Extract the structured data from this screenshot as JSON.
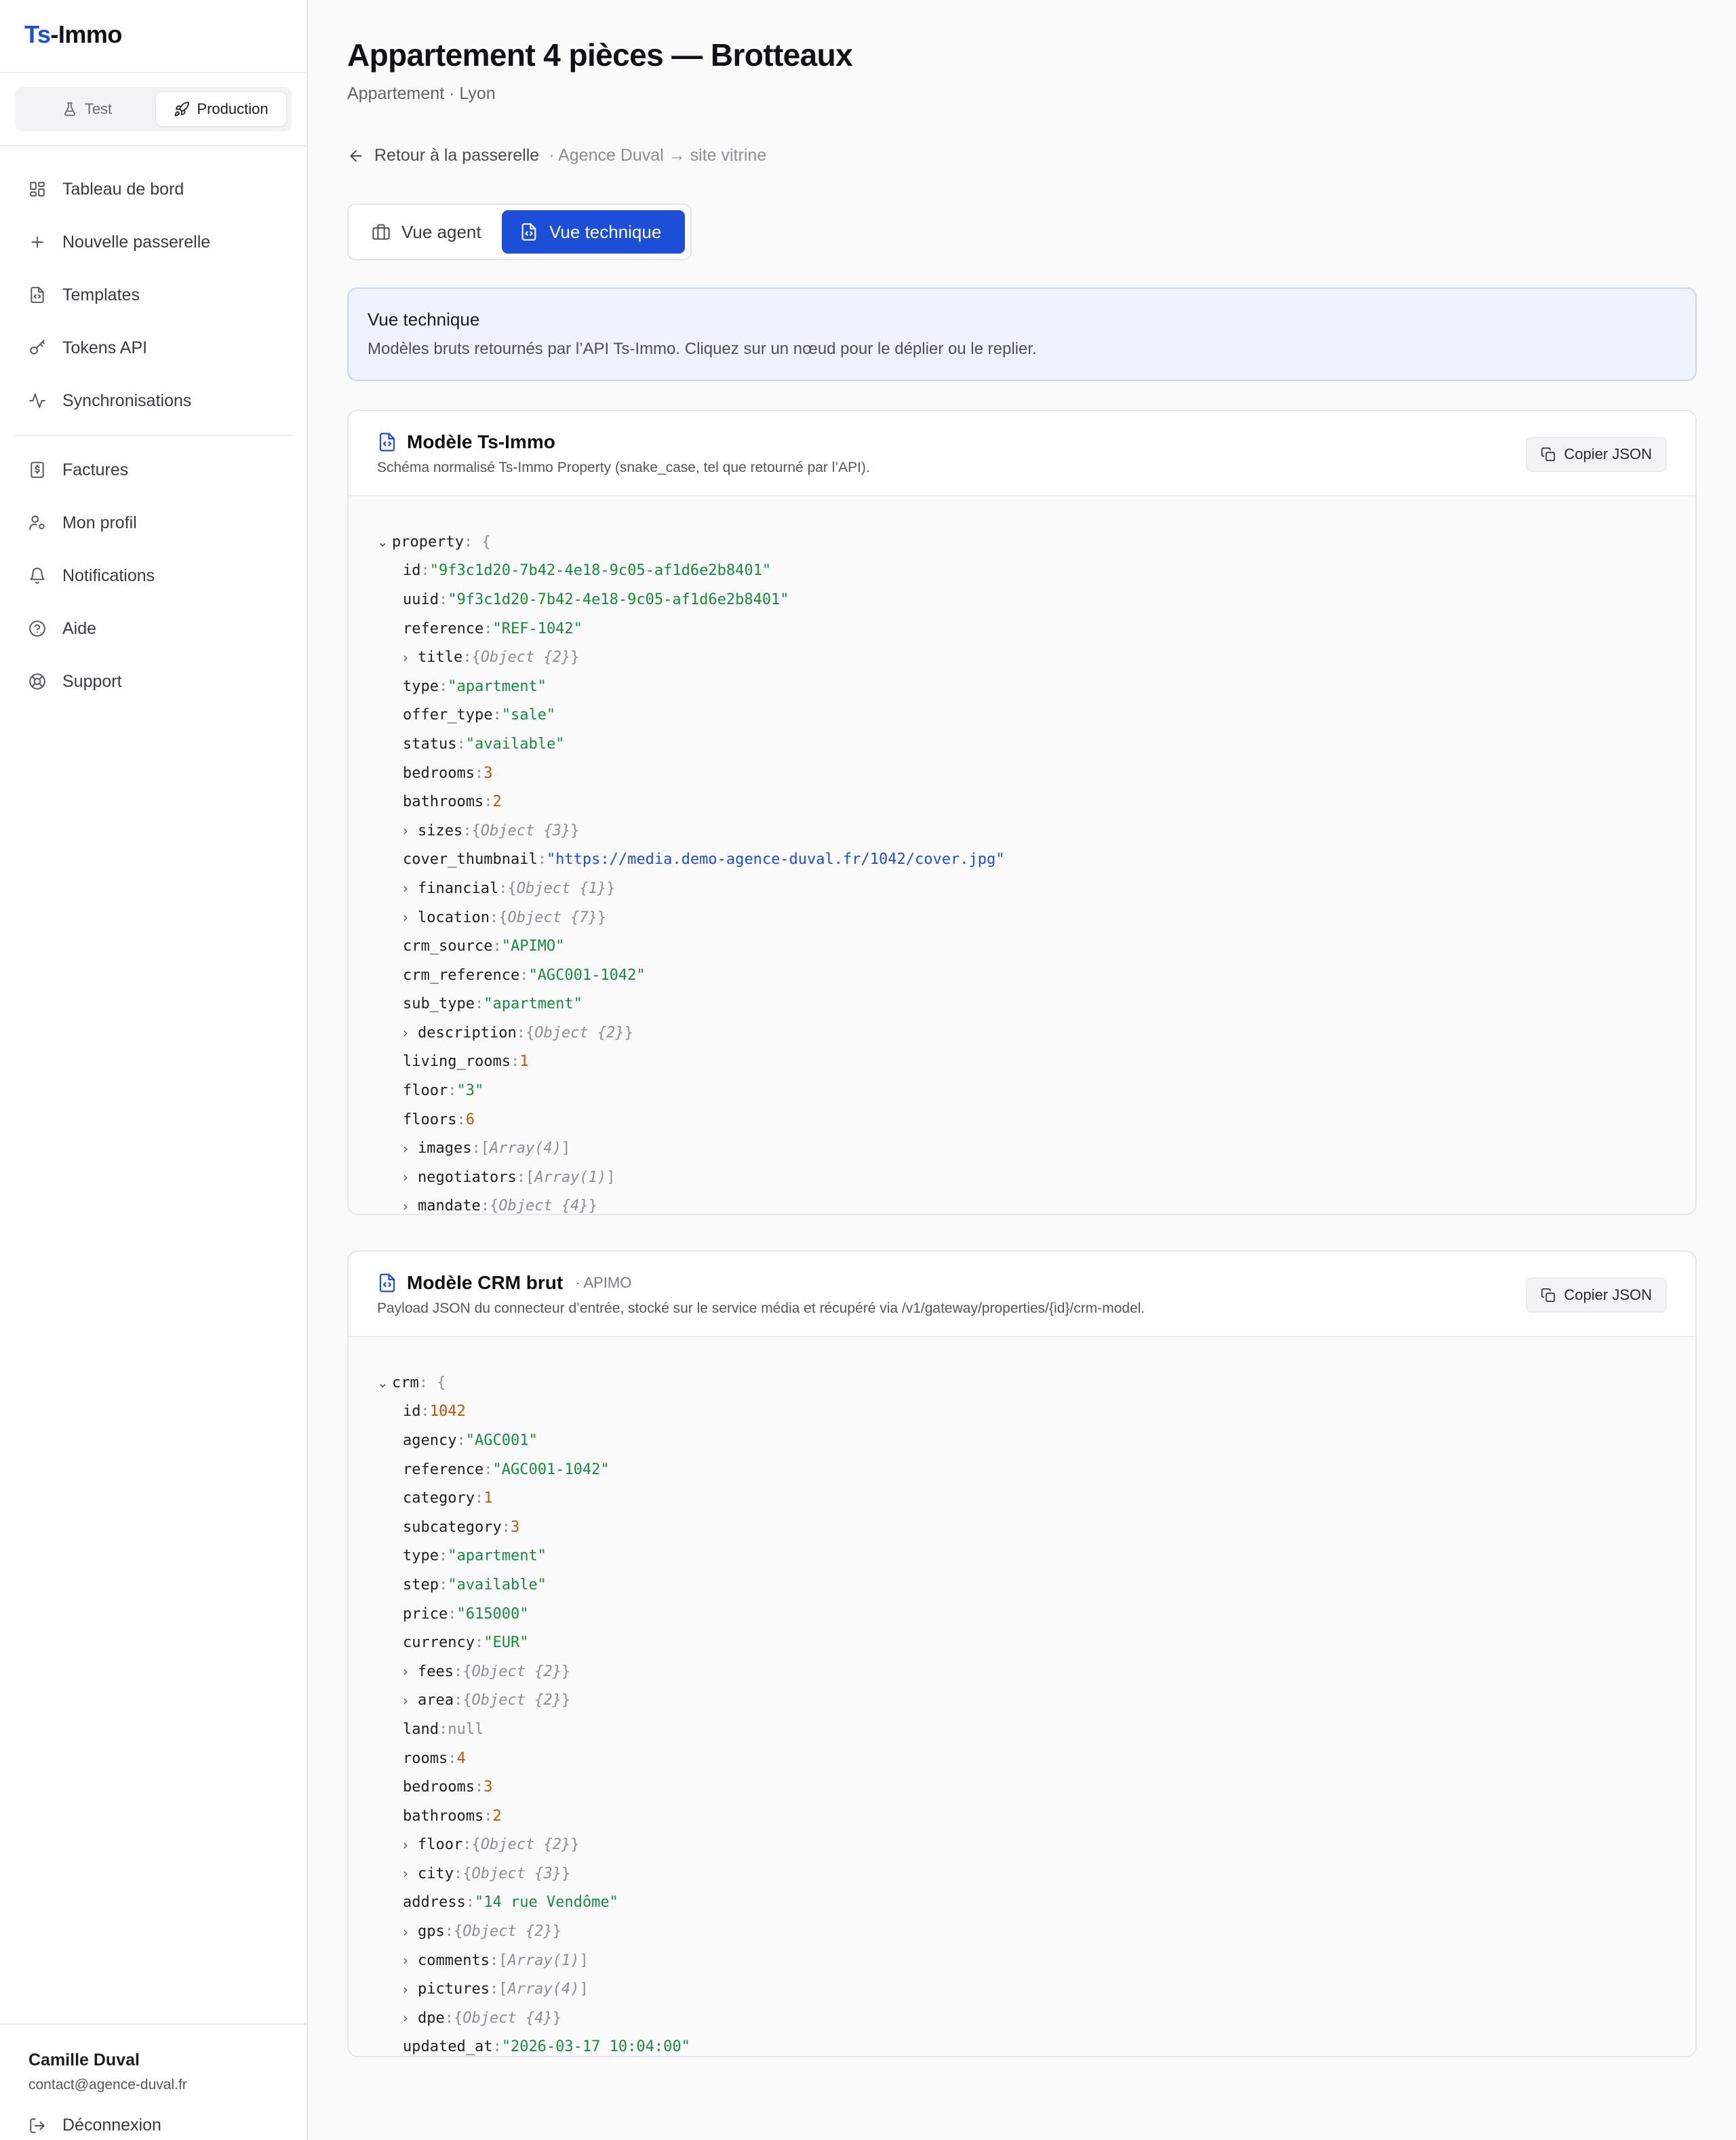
{
  "brand": {
    "prefix": "Ts",
    "suffix": "-Immo"
  },
  "env": {
    "test": "Test",
    "production": "Production",
    "active": "Production"
  },
  "nav": {
    "primary": [
      {
        "label": "Tableau de bord",
        "icon": "dashboard-icon"
      },
      {
        "label": "Nouvelle passerelle",
        "icon": "plus-icon"
      },
      {
        "label": "Templates",
        "icon": "file-code-icon"
      },
      {
        "label": "Tokens API",
        "icon": "key-icon"
      },
      {
        "label": "Synchronisations",
        "icon": "activity-icon"
      }
    ],
    "secondary": [
      {
        "label": "Factures",
        "icon": "receipt-icon"
      },
      {
        "label": "Mon profil",
        "icon": "user-cog-icon"
      },
      {
        "label": "Notifications",
        "icon": "bell-icon"
      },
      {
        "label": "Aide",
        "icon": "help-circle-icon"
      },
      {
        "label": "Support",
        "icon": "lifebuoy-icon"
      }
    ]
  },
  "user": {
    "name": "Camille Duval",
    "email": "contact@agence-duval.fr",
    "logout": "Déconnexion"
  },
  "page": {
    "title": "Appartement 4 pièces — Brotteaux",
    "subtitle": "Appartement · Lyon",
    "back_label": "Retour à la passerelle",
    "context": "· Agence Duval → site vitrine"
  },
  "views": {
    "agent": "Vue agent",
    "technical": "Vue technique",
    "active": "technical"
  },
  "info": {
    "title": "Vue technique",
    "text": "Modèles bruts retournés par l’API Ts-Immo. Cliquez sur un nœud pour le déplier ou le replier."
  },
  "cards": [
    {
      "title": "Modèle Ts-Immo",
      "tag": "",
      "desc": "Schéma normalisé Ts-Immo Property (snake_case, tel que retourné par l’API).",
      "copy_label": "Copier JSON",
      "root_key": "property",
      "rows": [
        {
          "key": "id",
          "kind": "str",
          "value": "\"9f3c1d20-7b42-4e18-9c05-af1d6e2b8401\""
        },
        {
          "key": "uuid",
          "kind": "str",
          "value": "\"9f3c1d20-7b42-4e18-9c05-af1d6e2b8401\""
        },
        {
          "key": "reference",
          "kind": "str",
          "value": "\"REF-1042\""
        },
        {
          "key": "title",
          "kind": "obj",
          "value": "Object {2}"
        },
        {
          "key": "type",
          "kind": "str",
          "value": "\"apartment\""
        },
        {
          "key": "offer_type",
          "kind": "str",
          "value": "\"sale\""
        },
        {
          "key": "status",
          "kind": "str",
          "value": "\"available\""
        },
        {
          "key": "bedrooms",
          "kind": "num",
          "value": "3"
        },
        {
          "key": "bathrooms",
          "kind": "num",
          "value": "2"
        },
        {
          "key": "sizes",
          "kind": "obj",
          "value": "Object {3}"
        },
        {
          "key": "cover_thumbnail",
          "kind": "url",
          "value": "\"https://media.demo-agence-duval.fr/1042/cover.jpg\""
        },
        {
          "key": "financial",
          "kind": "obj",
          "value": "Object {1}"
        },
        {
          "key": "location",
          "kind": "obj",
          "value": "Object {7}"
        },
        {
          "key": "crm_source",
          "kind": "str",
          "value": "\"APIMO\""
        },
        {
          "key": "crm_reference",
          "kind": "str",
          "value": "\"AGC001-1042\""
        },
        {
          "key": "sub_type",
          "kind": "str",
          "value": "\"apartment\""
        },
        {
          "key": "description",
          "kind": "obj",
          "value": "Object {2}"
        },
        {
          "key": "living_rooms",
          "kind": "num",
          "value": "1"
        },
        {
          "key": "floor",
          "kind": "str",
          "value": "\"3\""
        },
        {
          "key": "floors",
          "kind": "num",
          "value": "6"
        },
        {
          "key": "images",
          "kind": "arr",
          "value": "Array(4)"
        },
        {
          "key": "negotiators",
          "kind": "arr",
          "value": "Array(1)"
        },
        {
          "key": "mandate",
          "kind": "obj",
          "value": "Object {4}"
        }
      ]
    },
    {
      "title": "Modèle CRM brut",
      "tag": "· APIMO",
      "desc": "Payload JSON du connecteur d’entrée, stocké sur le service média et récupéré via /v1/gateway/properties/{id}/crm-model.",
      "copy_label": "Copier JSON",
      "root_key": "crm",
      "rows": [
        {
          "key": "id",
          "kind": "num",
          "value": "1042"
        },
        {
          "key": "agency",
          "kind": "str",
          "value": "\"AGC001\""
        },
        {
          "key": "reference",
          "kind": "str",
          "value": "\"AGC001-1042\""
        },
        {
          "key": "category",
          "kind": "num",
          "value": "1"
        },
        {
          "key": "subcategory",
          "kind": "num",
          "value": "3"
        },
        {
          "key": "type",
          "kind": "str",
          "value": "\"apartment\""
        },
        {
          "key": "step",
          "kind": "str",
          "value": "\"available\""
        },
        {
          "key": "price",
          "kind": "str",
          "value": "\"615000\""
        },
        {
          "key": "currency",
          "kind": "str",
          "value": "\"EUR\""
        },
        {
          "key": "fees",
          "kind": "obj",
          "value": "Object {2}"
        },
        {
          "key": "area",
          "kind": "obj",
          "value": "Object {2}"
        },
        {
          "key": "land",
          "kind": "null",
          "value": "null"
        },
        {
          "key": "rooms",
          "kind": "num",
          "value": "4"
        },
        {
          "key": "bedrooms",
          "kind": "num",
          "value": "3"
        },
        {
          "key": "bathrooms",
          "kind": "num",
          "value": "2"
        },
        {
          "key": "floor",
          "kind": "obj",
          "value": "Object {2}"
        },
        {
          "key": "city",
          "kind": "obj",
          "value": "Object {3}"
        },
        {
          "key": "address",
          "kind": "str",
          "value": "\"14 rue Vendôme\""
        },
        {
          "key": "gps",
          "kind": "obj",
          "value": "Object {2}"
        },
        {
          "key": "comments",
          "kind": "arr",
          "value": "Array(1)"
        },
        {
          "key": "pictures",
          "kind": "arr",
          "value": "Array(4)"
        },
        {
          "key": "dpe",
          "kind": "obj",
          "value": "Object {4}"
        },
        {
          "key": "updated_at",
          "kind": "str",
          "value": "\"2026-03-17 10:04:00\""
        }
      ]
    }
  ],
  "colors": {
    "accent": "#1d4ed8",
    "string": "#178a3e",
    "number": "#c2530a",
    "info_bg": "#eef2fd"
  }
}
